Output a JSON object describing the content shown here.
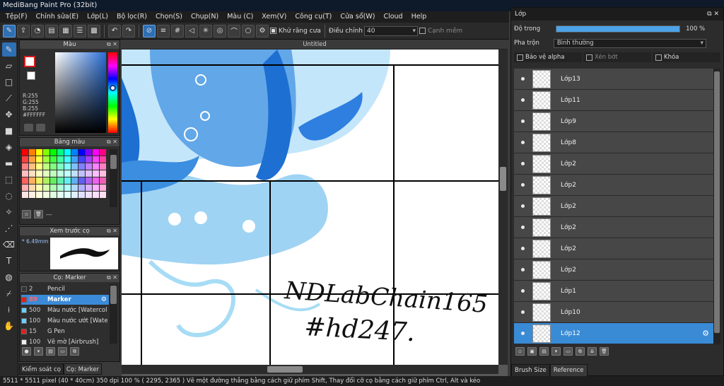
{
  "window": {
    "title": "MediBang Paint Pro (32bit)"
  },
  "menu": [
    "Tệp(F)",
    "Chỉnh sửa(E)",
    "Lớp(L)",
    "Bộ lọc(R)",
    "Chọn(S)",
    "Chụp(N)",
    "Màu (C)",
    "Xem(V)",
    "Công cụ(T)",
    "Cửa sổ(W)",
    "Cloud",
    "Help"
  ],
  "toolbar": {
    "antialias_label": "Khử răng cưa",
    "adjust_label": "Điều chỉnh",
    "adjust_value": "40",
    "snap_label": "Cạnh mềm"
  },
  "color_panel": {
    "title": "Màu",
    "rgb": [
      "R:255",
      "G:255",
      "B:255",
      "#FFFFFF"
    ],
    "main_color": "#FFFFFF",
    "sub_color": "#FFFFFF",
    "main_border": "#D81D1D"
  },
  "palette_panel": {
    "title": "Bảng màu",
    "footer_text": "---",
    "colors": [
      "#ff0000",
      "#ff8000",
      "#ffff00",
      "#80ff00",
      "#00ff00",
      "#00ff80",
      "#00ffff",
      "#0080ff",
      "#0000ff",
      "#8000ff",
      "#ff00ff",
      "#ff0080",
      "#ff4040",
      "#ffa040",
      "#ffff40",
      "#a0ff40",
      "#40ff40",
      "#40ffa0",
      "#40ffff",
      "#40a0ff",
      "#4040ff",
      "#a040ff",
      "#ff40ff",
      "#ff40a0",
      "#ff8080",
      "#ffc080",
      "#ffff80",
      "#c0ff80",
      "#80ff80",
      "#80ffc0",
      "#80ffff",
      "#80c0ff",
      "#8080ff",
      "#c080ff",
      "#ff80ff",
      "#ff80c0",
      "#ffc0c0",
      "#ffe0c0",
      "#ffffc0",
      "#e0ffc0",
      "#c0ffc0",
      "#c0ffe0",
      "#c0ffff",
      "#c0e0ff",
      "#c0c0ff",
      "#e0c0ff",
      "#ffc0ff",
      "#ffc0e0",
      "#ff6060",
      "#ffb060",
      "#f0f060",
      "#b0f060",
      "#60f060",
      "#60f0b0",
      "#60f0f0",
      "#60b0f0",
      "#6060f0",
      "#b060f0",
      "#f060f0",
      "#f060b0",
      "#ffb0b0",
      "#ffd8b0",
      "#ffffb0",
      "#d8ffb0",
      "#b0ffb0",
      "#b0ffd8",
      "#b0ffff",
      "#b0d8ff",
      "#b0b0ff",
      "#d8b0ff",
      "#ffb0ff",
      "#ffb0d8",
      "#ffe4e4",
      "#fff0e0",
      "#ffffe0",
      "#f0ffe0",
      "#e0ffe0",
      "#e0fff0",
      "#e0ffff",
      "#e0f0ff",
      "#e0e0ff",
      "#f0e0ff",
      "#ffe0ff",
      "#ffe0f0"
    ]
  },
  "preview_panel": {
    "title": "Xem trước cọ",
    "size_label": "* 6.49mm"
  },
  "brush_panel": {
    "title": "Cọ: Marker",
    "brushes": [
      {
        "size": "2",
        "name": "Pencil",
        "color": "#333333"
      },
      {
        "size": "89",
        "name": "Marker",
        "color": "#e02020",
        "selected": true
      },
      {
        "size": "500",
        "name": "Màu nước [Watercol",
        "color": "#6ad0ff"
      },
      {
        "size": "100",
        "name": "Màu nước ướt [Wate",
        "color": "#6ad0ff"
      },
      {
        "size": "15",
        "name": "G Pen",
        "color": "#e02020"
      },
      {
        "size": "100",
        "name": "Vẽ mờ [Airbrush]",
        "color": "#eeeeee"
      }
    ]
  },
  "left_tabs": [
    "Kiểm soát cọ",
    "Cọ: Marker"
  ],
  "canvas": {
    "tab_title": "Untitled",
    "text_line1": "NDLabChain165",
    "text_line2": "#hd247."
  },
  "layer_panel": {
    "title": "Lớp",
    "opacity_label": "Độ trong",
    "opacity_value": "100 %",
    "opacity_fraction": 1.0,
    "blend_label": "Pha trộn",
    "blend_value": "Bình thường",
    "protect_alpha": "Bảo vệ alpha",
    "clipping": "Xén bớt",
    "lock": "Khóa",
    "layers": [
      {
        "name": "Lớp13"
      },
      {
        "name": "Lớp11"
      },
      {
        "name": "Lớp9"
      },
      {
        "name": "Lớp8"
      },
      {
        "name": "Lớp2"
      },
      {
        "name": "Lớp2"
      },
      {
        "name": "Lớp2"
      },
      {
        "name": "Lớp2"
      },
      {
        "name": "Lớp2"
      },
      {
        "name": "Lớp2"
      },
      {
        "name": "Lớp1"
      },
      {
        "name": "Lớp10"
      },
      {
        "name": "Lớp12",
        "selected": true
      }
    ]
  },
  "right_tabs": [
    "Brush Size",
    "Reference"
  ],
  "status": {
    "text": "5511 * 5511 pixel  (40 * 40cm)  350 dpi  100 %  ( 2295, 2365 )  Vẽ một đường thẳng bằng cách giữ phím Shift, Thay đổi cỡ cọ bằng cách giữ phím Ctrl, Alt và kéo"
  }
}
